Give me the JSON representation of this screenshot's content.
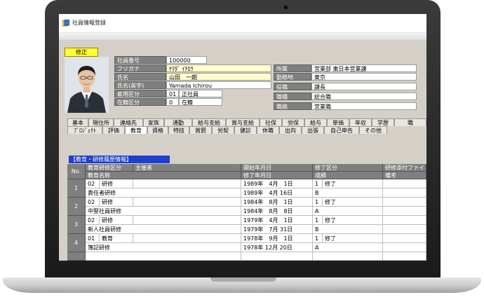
{
  "window": {
    "title": "社員情報登録"
  },
  "mode_badge": "修正",
  "employee": {
    "fields": [
      {
        "key": "emp_no",
        "label": "社員番号",
        "value": "100000"
      },
      {
        "key": "furigana",
        "label": "フリガナ",
        "value": "ﾔﾏﾀﾞ ｲﾁﾛｳ"
      },
      {
        "key": "name",
        "label": "氏名",
        "value": "山田　一朗"
      },
      {
        "key": "name_en",
        "label": "氏名(英字)",
        "value": "Yamada Ichirou"
      },
      {
        "key": "employment",
        "label": "雇用区分",
        "code": "01",
        "value": "正社員"
      },
      {
        "key": "status",
        "label": "在籍区分",
        "code": "0",
        "value": "在籍"
      }
    ],
    "right_fields": [
      {
        "key": "department",
        "label": "所属",
        "value": "営業部 東日本営業課"
      },
      {
        "key": "location",
        "label": "勤務地",
        "value": "東京"
      },
      {
        "key": "position",
        "label": "役職",
        "value": "課長"
      },
      {
        "key": "job_type",
        "label": "職種",
        "value": "総合職"
      },
      {
        "key": "duty",
        "label": "職務",
        "value": "営業職"
      }
    ]
  },
  "tabs_row1": [
    "基本",
    "現住所",
    "連絡先",
    "家族",
    "通勤",
    "給与支給",
    "賞与支給",
    "社保",
    "労保",
    "給与",
    "単価",
    "年収",
    "学歴",
    "職"
  ],
  "tabs_row2": [
    "ﾌﾟﾛｼﾞｪｸﾄ",
    "評価",
    "教育",
    "資格",
    "特技",
    "賞罰",
    "労契",
    "健診",
    "休職",
    "出向",
    "出張",
    "自己申告",
    "その他"
  ],
  "active_tab": "教育",
  "section_title": "【教育・研修履歴情報】",
  "grid": {
    "no_header": "No.",
    "headers_row1": [
      "教育研修区分",
      "主催者",
      "開始年月日",
      "修了区分",
      "研修添付ファイ"
    ],
    "headers_row2": [
      "教育名称",
      "修了年月日",
      "成績",
      "備考"
    ],
    "rows": [
      {
        "no": "1",
        "cat_code": "02",
        "cat": "研修",
        "name": "責任者研修",
        "start": "1989年　4月　1日",
        "end": "1989年　4月 16日",
        "done_code": "1",
        "done": "修了",
        "grade": "B"
      },
      {
        "no": "2",
        "cat_code": "02",
        "cat": "研修",
        "name": "中堅社員研修",
        "start": "1984年　8月　1日",
        "end": "1984年　8月　8日",
        "done_code": "1",
        "done": "修了",
        "grade": "A"
      },
      {
        "no": "3",
        "cat_code": "02",
        "cat": "研修",
        "name": "新人社員研修",
        "start": "1979年　4月　1日",
        "end": "1979年　7月 31日",
        "done_code": "1",
        "done": "修了",
        "grade": "B"
      },
      {
        "no": "4",
        "cat_code": "01",
        "cat": "教育",
        "name": "簿記研修",
        "start": "1978年　9月　1日",
        "end": "1978年 12月 20日",
        "done_code": "1",
        "done": "修了",
        "grade": "A"
      }
    ]
  }
}
